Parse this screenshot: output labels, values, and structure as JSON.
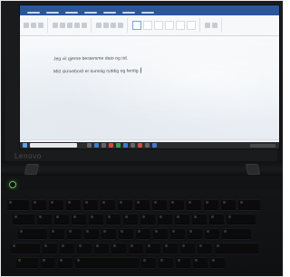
{
  "photo": {
    "document_lines": [
      "Jeg vil gjerne bestemme dato og tid.",
      "Mitt skrivebord er kunstig ryddig og ferdig."
    ],
    "brand": "Lenovo"
  },
  "colors": {
    "word_blue": "#2b579a",
    "taskbar": "#2a2b2e",
    "laptop_body": "#141516",
    "power_led": "#8cff78"
  }
}
